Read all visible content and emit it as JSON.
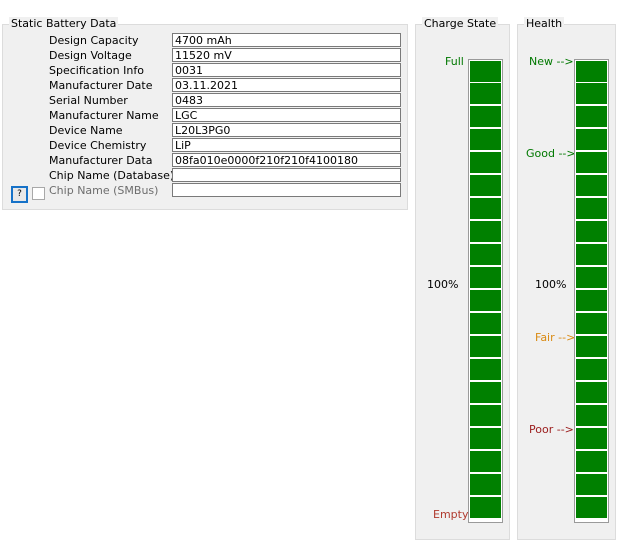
{
  "static": {
    "title": "Static Battery Data",
    "rows": [
      {
        "label": "Design Capacity",
        "value": "4700 mAh"
      },
      {
        "label": "Design Voltage",
        "value": "11520 mV"
      },
      {
        "label": "Specification Info",
        "value": "0031"
      },
      {
        "label": "Manufacturer Date",
        "value": "03.11.2021"
      },
      {
        "label": "Serial Number",
        "value": "0483"
      },
      {
        "label": "Manufacturer Name",
        "value": "LGC"
      },
      {
        "label": "Device Name",
        "value": "L20L3PG0"
      },
      {
        "label": "Device Chemistry",
        "value": "LiP"
      },
      {
        "label": "Manufacturer Data",
        "value": "08fa010e0000f210f210f4100180"
      },
      {
        "label": "Chip Name (Database)",
        "value": ""
      },
      {
        "label": "Chip Name (SMBus)",
        "value": ""
      }
    ],
    "help_label": "?"
  },
  "charge": {
    "title": "Charge State",
    "full_label": "Full",
    "percent_label": "100%",
    "empty_label": "Empty",
    "level": 1.0,
    "fill_color": "#008000"
  },
  "health": {
    "title": "Health",
    "new_label": "New -->",
    "good_label": "Good -->",
    "percent_label": "100%",
    "fair_label": "Fair -->",
    "poor_label": "Poor -->",
    "level": 1.0,
    "fill_color": "#008000"
  }
}
